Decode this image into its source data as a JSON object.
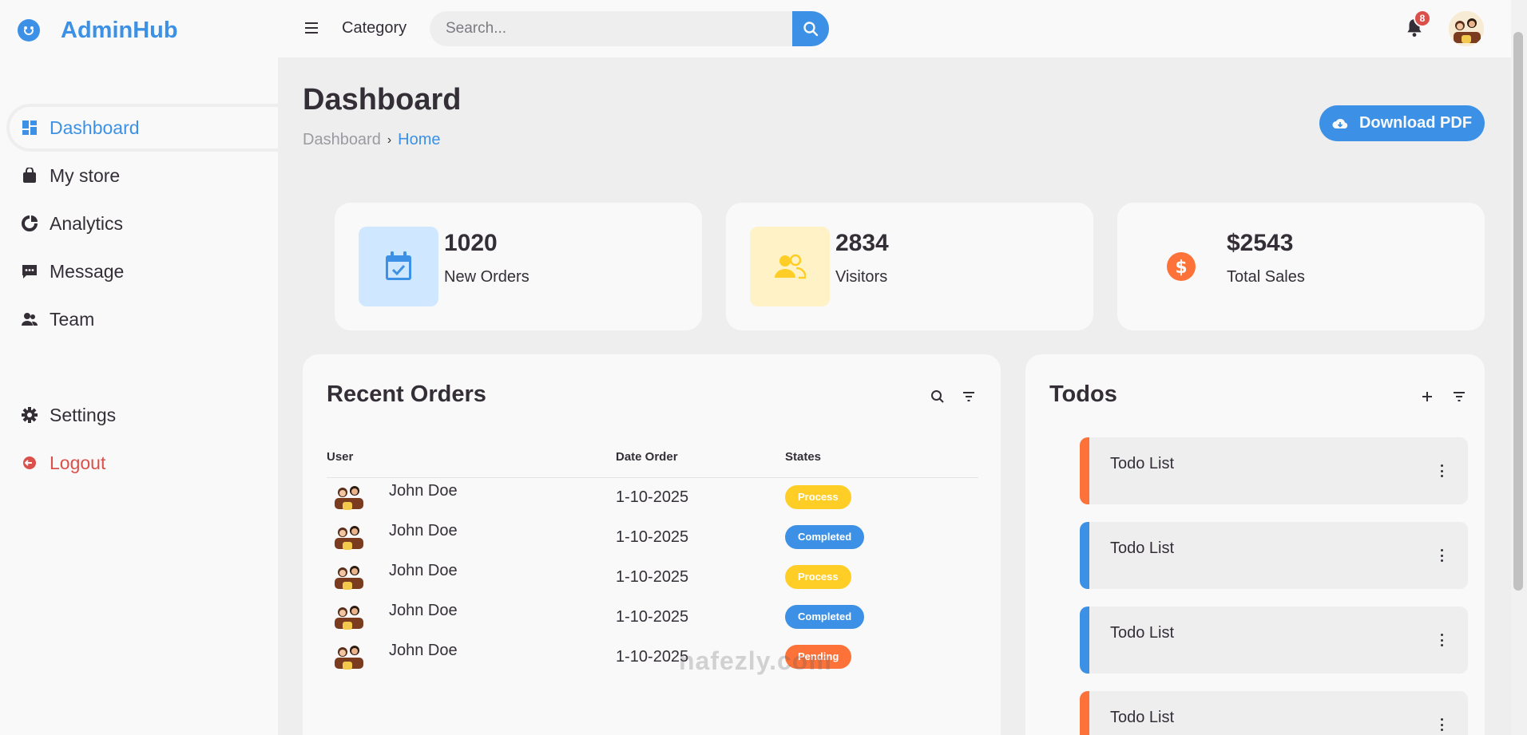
{
  "brand": {
    "name": "AdminHub"
  },
  "sidebar": {
    "top_items": [
      {
        "label": "Dashboard",
        "icon": "dashboard-icon",
        "active": true
      },
      {
        "label": "My store",
        "icon": "shopping-bag-icon"
      },
      {
        "label": "Analytics",
        "icon": "pie-chart-icon"
      },
      {
        "label": "Message",
        "icon": "message-icon"
      },
      {
        "label": "Team",
        "icon": "team-icon"
      }
    ],
    "bottom_items": [
      {
        "label": "Settings",
        "icon": "gear-icon"
      },
      {
        "label": "Logout",
        "icon": "logout-icon"
      }
    ]
  },
  "topbar": {
    "category": "Category",
    "search_placeholder": "Search...",
    "notification_count": "8"
  },
  "header": {
    "title": "Dashboard",
    "breadcrumb": [
      "Dashboard",
      "Home"
    ],
    "download_label": "Download PDF"
  },
  "stats": [
    {
      "value": "1020",
      "label": "New Orders"
    },
    {
      "value": "2834",
      "label": "Visitors"
    },
    {
      "value": "$2543",
      "label": "Total Sales"
    }
  ],
  "orders": {
    "title": "Recent Orders",
    "columns": [
      "User",
      "Date Order",
      "States"
    ],
    "rows": [
      {
        "user": "John Doe",
        "date": "1-10-2025",
        "state": "Process"
      },
      {
        "user": "John Doe",
        "date": "1-10-2025",
        "state": "Completed"
      },
      {
        "user": "John Doe",
        "date": "1-10-2025",
        "state": "Process"
      },
      {
        "user": "John Doe",
        "date": "1-10-2025",
        "state": "Completed"
      },
      {
        "user": "John Doe",
        "date": "1-10-2025",
        "state": "Pending"
      }
    ]
  },
  "todos": {
    "title": "Todos",
    "items": [
      {
        "label": "Todo List",
        "status": "not-completed"
      },
      {
        "label": "Todo List",
        "status": "completed"
      },
      {
        "label": "Todo List",
        "status": "completed"
      },
      {
        "label": "Todo List",
        "status": "not-completed"
      }
    ]
  },
  "watermark": "nafezly.com",
  "colors": {
    "blue": "#3c91e6",
    "light_blue": "#cfe8ff",
    "yellow": "#ffce26",
    "light_yellow": "#fff2c6",
    "orange": "#fd7238",
    "red": "#db504a",
    "grey": "#eeeeef",
    "light": "#f9f9f9",
    "dark": "#342e37"
  }
}
